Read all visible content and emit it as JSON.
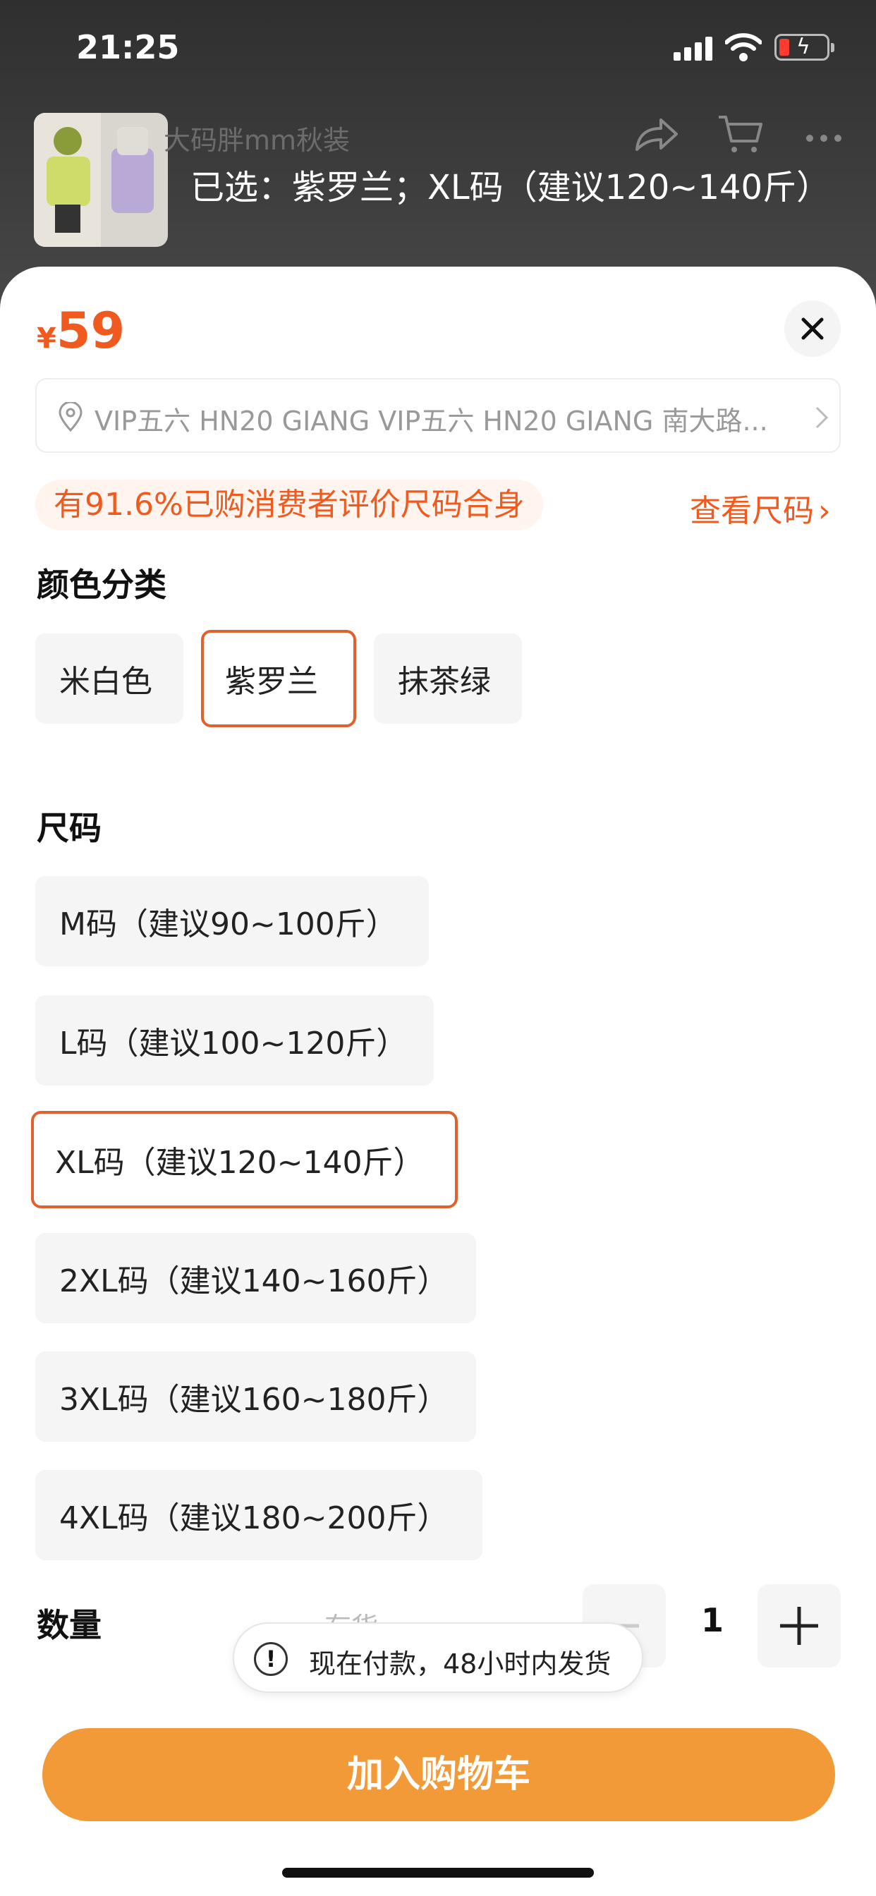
{
  "status_bar": {
    "time": "21:25"
  },
  "background": {
    "title": "大码胖mm秋装",
    "selected_text": "已选：紫罗兰；XL码（建议120~140斤）"
  },
  "sheet": {
    "price": {
      "currency": "¥",
      "value": "59"
    },
    "address": "VIP五六 HN20 GIANG VIP五六 HN20 GIANG 南大路...",
    "fit_info": "有91.6%已购消费者评价尺码合身",
    "size_guide_label": "查看尺码",
    "color_section": {
      "title": "颜色分类",
      "options": [
        "米白色",
        "紫罗兰",
        "抹茶绿"
      ],
      "selected": "紫罗兰"
    },
    "size_section": {
      "title": "尺码",
      "options": [
        "M码（建议90~100斤）",
        "L码（建议100~120斤）",
        "XL码（建议120~140斤）",
        "2XL码（建议140~160斤）",
        "3XL码（建议160~180斤）",
        "4XL码（建议180~200斤）"
      ],
      "selected": "XL码（建议120~140斤）"
    },
    "quantity": {
      "label": "数量",
      "stock_text": "有货",
      "value": "1"
    },
    "notice": "现在付款，48小时内发货",
    "add_to_cart_label": "加入购物车"
  },
  "colors": {
    "accent": "#f05a1e",
    "button": "#f29a38"
  }
}
